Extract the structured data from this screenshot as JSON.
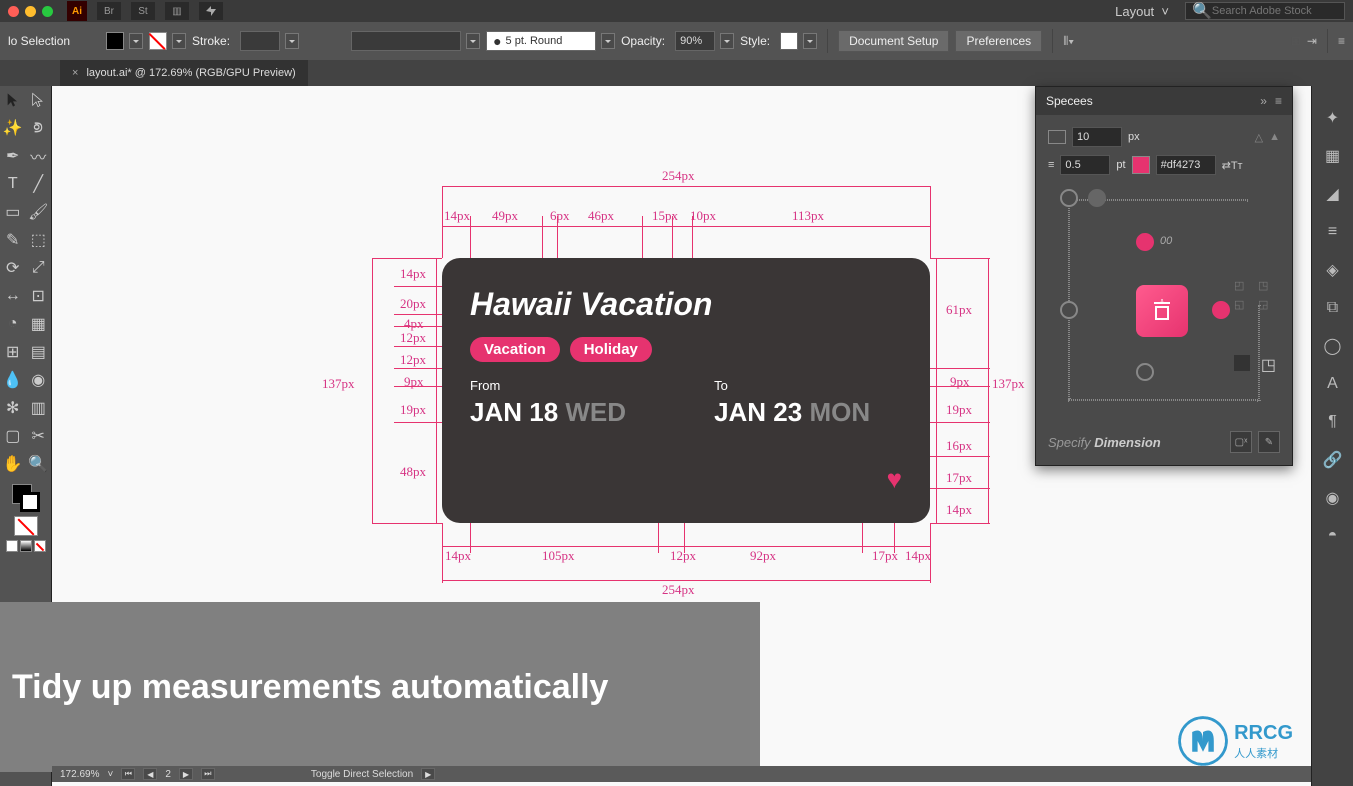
{
  "macbar": {
    "app": "Ai",
    "br": "Br",
    "st": "St",
    "layout": "Layout",
    "search_placeholder": "Search Adobe Stock"
  },
  "controlbar": {
    "selection": "lo Selection",
    "stroke_label": "Stroke:",
    "point_label": "5 pt. Round",
    "opacity_label": "Opacity:",
    "opacity_value": "90%",
    "style_label": "Style:",
    "doc_setup": "Document Setup",
    "prefs": "Preferences"
  },
  "tab": {
    "name": "layout.ai* @ 172.69% (RGB/GPU Preview)"
  },
  "card": {
    "title": "Hawaii Vacation",
    "tag1": "Vacation",
    "tag2": "Holiday",
    "from": "From",
    "to": "To",
    "date1_main": "JAN 18",
    "date1_day": "WED",
    "date2_main": "JAN 23",
    "date2_day": "MON"
  },
  "dims": {
    "top_total": "254px",
    "top_14": "14px",
    "top_49": "49px",
    "top_6": "6px",
    "top_46": "46px",
    "top_15": "15px",
    "top_10": "10px",
    "top_113": "113px",
    "left_137": "137px",
    "left_14": "14px",
    "left_20": "20px",
    "left_4": "4px",
    "left_12a": "12px",
    "left_12b": "12px",
    "left_9": "9px",
    "left_19": "19px",
    "left_48": "48px",
    "right_137": "137px",
    "right_61": "61px",
    "right_9": "9px",
    "right_19": "19px",
    "right_16": "16px",
    "right_17": "17px",
    "right_14": "14px",
    "bottom_254": "254px",
    "bottom_14": "14px",
    "bottom_105": "105px",
    "bottom_12": "12px",
    "bottom_92": "92px",
    "bottom_17": "17px",
    "bottom_14b": "14px"
  },
  "specees": {
    "title": "Specees",
    "size_value": "10",
    "size_unit": "px",
    "stroke_value": "0.5",
    "stroke_unit": "pt",
    "color_hex": "#df4273",
    "hint_00": "00",
    "footer_label": "Specify Dimension"
  },
  "caption": {
    "text": "Tidy up measurements automatically"
  },
  "watermark": {
    "main": "RRCG",
    "sub": "人人素材"
  },
  "statusbar": {
    "zoom": "172.69%",
    "page": "2",
    "mode": "Toggle Direct Selection"
  }
}
